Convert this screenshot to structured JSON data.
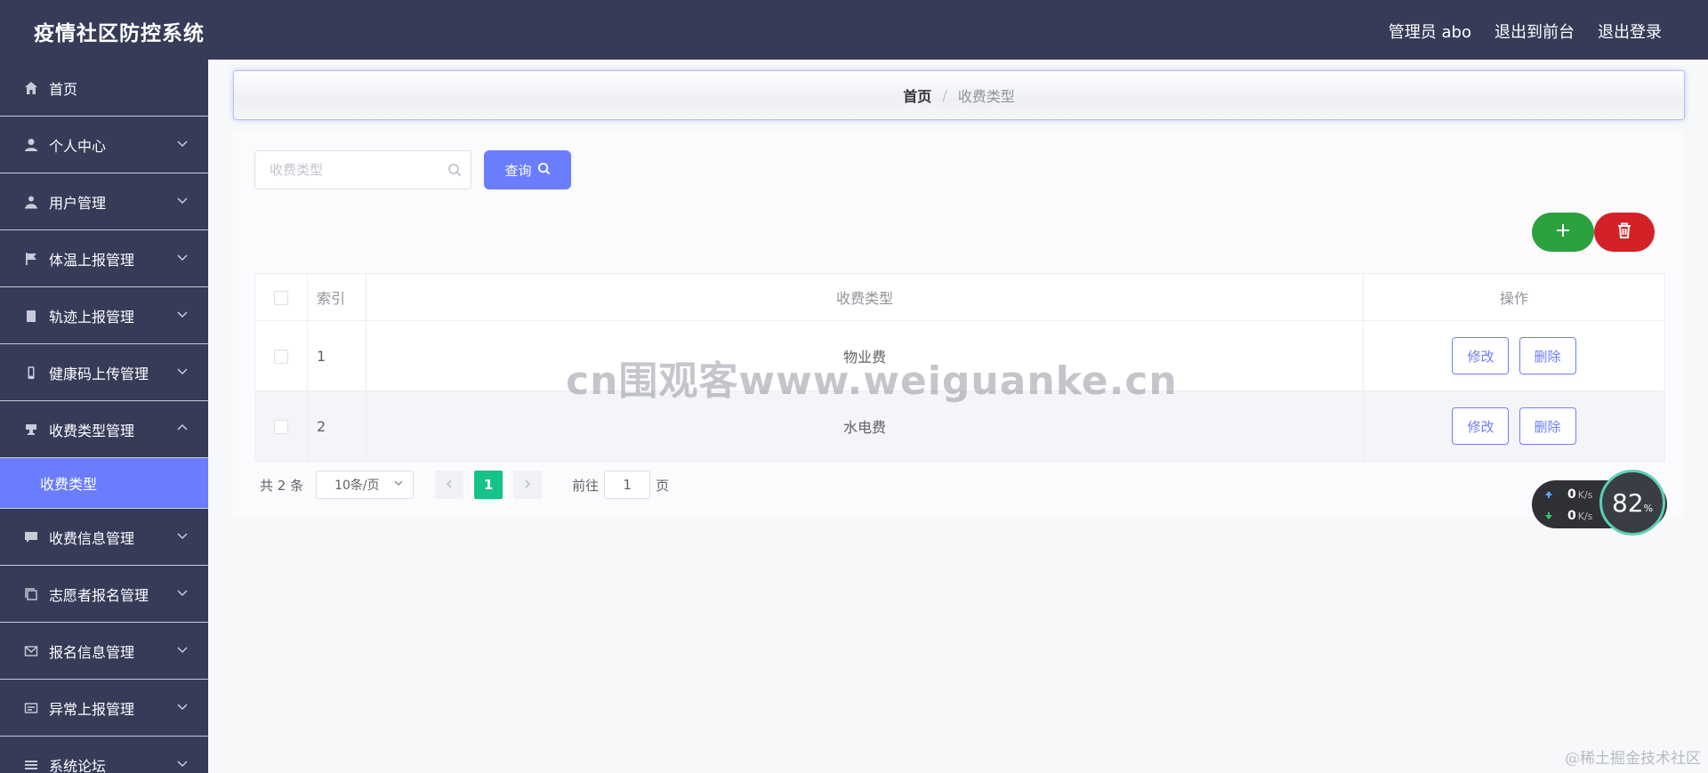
{
  "header": {
    "app_title": "疫情社区防控系统",
    "admin_label": "管理员 abo",
    "frontend_label": "退出到前台",
    "logout_label": "退出登录"
  },
  "sidebar": {
    "items": [
      {
        "label": "首页",
        "icon": "home-icon"
      },
      {
        "label": "个人中心",
        "icon": "user-icon"
      },
      {
        "label": "用户管理",
        "icon": "user-manage-icon"
      },
      {
        "label": "体温上报管理",
        "icon": "flag-icon"
      },
      {
        "label": "轨迹上报管理",
        "icon": "clipboard-icon"
      },
      {
        "label": "健康码上传管理",
        "icon": "phone-icon"
      },
      {
        "label": "收费类型管理",
        "icon": "stamp-icon"
      },
      {
        "label": "收费信息管理",
        "icon": "message-icon"
      },
      {
        "label": "志愿者报名管理",
        "icon": "copy-icon"
      },
      {
        "label": "报名信息管理",
        "icon": "mail-icon"
      },
      {
        "label": "异常上报管理",
        "icon": "card-icon"
      },
      {
        "label": "系统论坛",
        "icon": "list-icon"
      }
    ],
    "active_sub": "收费类型"
  },
  "breadcrumb": {
    "home": "首页",
    "separator": "/",
    "current": "收费类型"
  },
  "search": {
    "placeholder": "收费类型",
    "value": "",
    "query_label": "查询"
  },
  "table": {
    "headers": [
      "索引",
      "收费类型",
      "操作"
    ],
    "rows": [
      {
        "index": "1",
        "type": "物业费"
      },
      {
        "index": "2",
        "type": "水电费"
      }
    ],
    "edit_label": "修改",
    "delete_label": "删除"
  },
  "pagination": {
    "total": "共 2 条",
    "page_size": "10条/页",
    "current_page": "1",
    "goto_label": "前往",
    "goto_value": "1",
    "page_unit": "页"
  },
  "overlay": {
    "watermark": "cn围观客www.weiguanke.cn",
    "upload_speed": "0",
    "download_speed": "0",
    "speed_unit": "K/s",
    "gauge_value": "82",
    "gauge_unit": "%",
    "corner_watermark": "@稀土掘金技术社区"
  },
  "colors": {
    "sidebar_bg": "#363b58",
    "accent": "#6b7dff",
    "add_green": "#2ba13f",
    "delete_red": "#d42027",
    "page_active": "#16c28a"
  }
}
